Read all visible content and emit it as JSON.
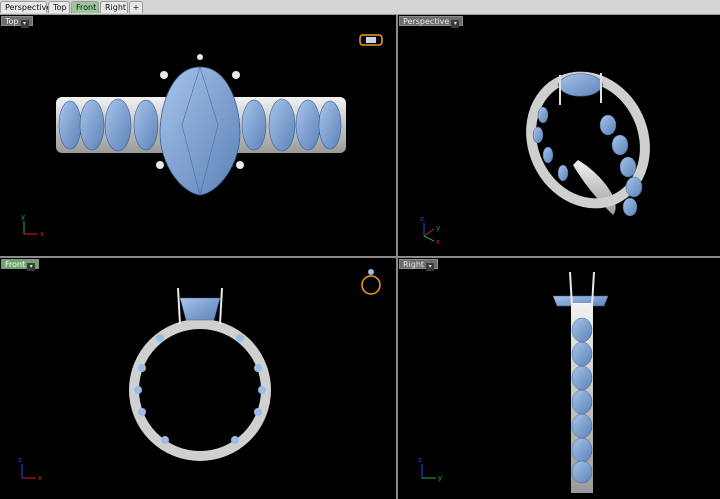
{
  "tabs": [
    "Perspective",
    "Top",
    "Front",
    "Right"
  ],
  "active_tab": "Front",
  "add_tab_icon": "plus-icon",
  "viewports": {
    "top": {
      "label": "Top",
      "axes": {
        "x": "x",
        "y": "y"
      }
    },
    "perspective": {
      "label": "Perspective",
      "axes": {
        "x": "x",
        "y": "y",
        "z": "z"
      }
    },
    "front": {
      "label": "Front",
      "axes": {
        "x": "x",
        "z": "z"
      }
    },
    "right": {
      "label": "Right",
      "axes": {
        "y": "y",
        "z": "z"
      }
    }
  },
  "active_viewport": "Front",
  "colors": {
    "background": "#000000",
    "gem": "#7fa6d9",
    "metal": "#d9d9d9",
    "active": "#6ea66a",
    "nav_orange": "#f0a020"
  }
}
